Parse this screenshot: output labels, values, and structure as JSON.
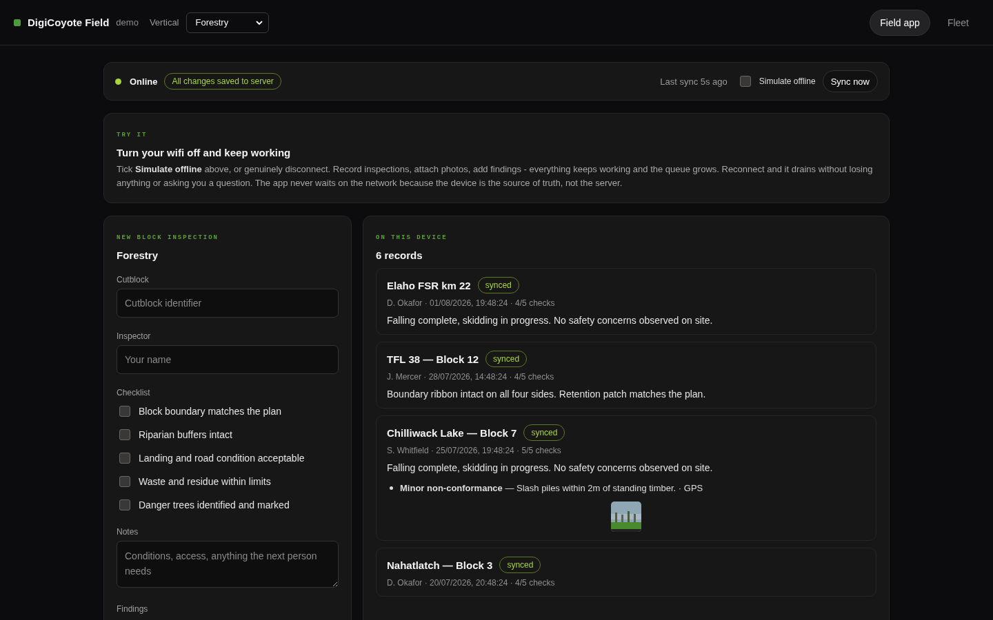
{
  "header": {
    "brand": "DigiCoyote Field",
    "tag": "demo",
    "vertical_label": "Vertical",
    "vertical_value": "Forestry",
    "nav": [
      {
        "label": "Field app",
        "selected": true
      },
      {
        "label": "Fleet",
        "selected": false
      }
    ]
  },
  "status_bar": {
    "online": true,
    "status": "Online",
    "saved": "All changes saved to server",
    "last_sync": "Last sync 5s ago",
    "simulate_offline": {
      "label": "Simulate offline",
      "checked": false
    },
    "sync_button": "Sync now"
  },
  "tip": {
    "eyebrow": "TRY IT",
    "title": "Turn your wifi off and keep working",
    "body": "Tick **Simulate offline** above, or genuinely disconnect. Record inspections, attach photos, add findings - everything keeps working and the queue grows. Reconnect and it drains without losing anything or asking you a question. The app never waits on the network because the device is the source of truth, not the server."
  },
  "form": {
    "eyebrow": "NEW BLOCK INSPECTION",
    "title": "Forestry",
    "fields": [
      {
        "label": "Cutblock",
        "placeholder": "Cutblock identifier"
      },
      {
        "label": "Inspector",
        "placeholder": "Your name"
      }
    ],
    "checklist_label": "Checklist",
    "checklist": [
      {
        "label": "Block boundary matches the plan",
        "checked": false
      },
      {
        "label": "Riparian buffers intact",
        "checked": false
      },
      {
        "label": "Landing and road condition acceptable",
        "checked": false
      },
      {
        "label": "Waste and residue within limits",
        "checked": false
      },
      {
        "label": "Danger trees identified and marked",
        "checked": false
      }
    ],
    "notes_label": "Notes",
    "notes_placeholder": "Conditions, access, anything the next person needs",
    "findings_label": "Findings"
  },
  "records": {
    "eyebrow": "ON THIS DEVICE",
    "title": "6 records",
    "items": [
      {
        "title": "Elaho FSR km 22",
        "status": "synced",
        "meta": "D. Okafor · 01/08/2026, 19:48:24 · 4/5 checks",
        "note": "Falling complete, skidding in progress. No safety concerns observed on site."
      },
      {
        "title": "TFL 38 — Block 12",
        "status": "synced",
        "meta": "J. Mercer · 28/07/2026, 14:48:24 · 4/5 checks",
        "note": "Boundary ribbon intact on all four sides. Retention patch matches the plan."
      },
      {
        "title": "Chilliwack Lake — Block 7",
        "status": "synced",
        "meta": "S. Whitfield · 25/07/2026, 19:48:24 · 5/5 checks",
        "note": "Falling complete, skidding in progress. No safety concerns observed on site.",
        "findings": [
          "**Minor non-conformance** — Slash piles within 2m of standing timber. · GPS"
        ],
        "photos": [
          {
            "kind": "picture"
          }
        ]
      },
      {
        "title": "Nahatlatch — Block 3",
        "status": "synced",
        "meta": "D. Okafor · 20/07/2026, 20:48:24 · 4/5 checks"
      }
    ]
  }
}
